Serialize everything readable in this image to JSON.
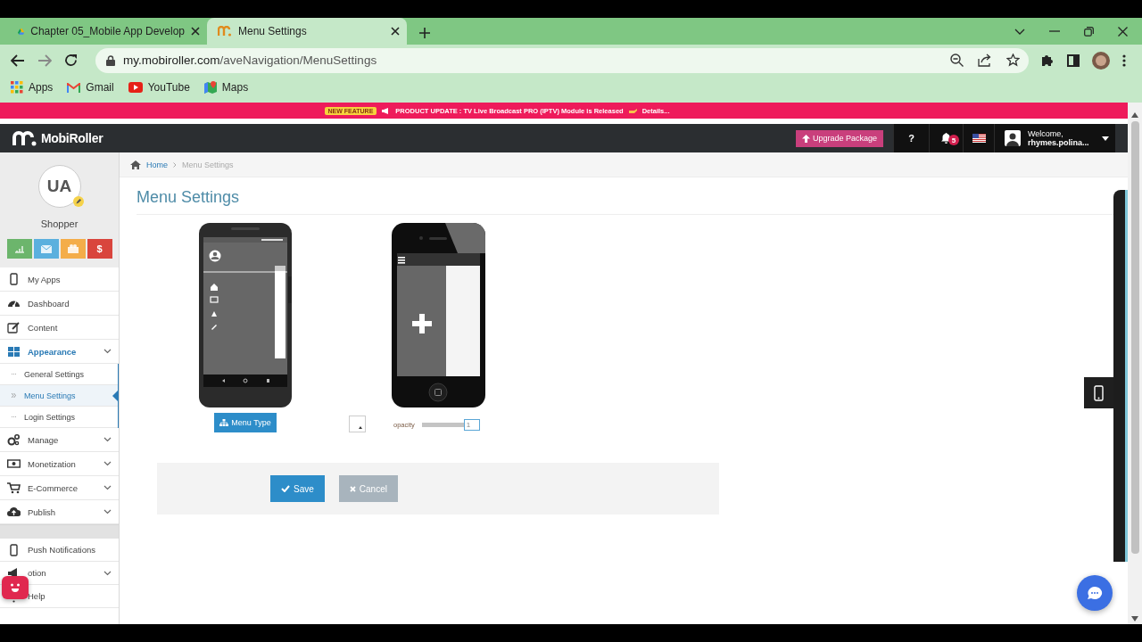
{
  "browser": {
    "tabs": [
      {
        "title": "Chapter 05_Mobile App Develop",
        "selected": false
      },
      {
        "title": "Menu Settings",
        "selected": true
      }
    ],
    "address": {
      "host": "my.mobiroller.com",
      "path": "/aveNavigation/MenuSettings"
    },
    "bookmarks": [
      {
        "label": "Apps"
      },
      {
        "label": "Gmail"
      },
      {
        "label": "YouTube"
      },
      {
        "label": "Maps"
      }
    ]
  },
  "banner": {
    "badge": "NEW FEATURE",
    "text": "PRODUCT UPDATE : TV Live Broadcast PRO (IPTV) Module is Released",
    "link": "Details..."
  },
  "header": {
    "logo": "MobiRoller",
    "upgrade_button": "Upgrade Package",
    "help": "?",
    "notification_count": "5",
    "welcome": "Welcome,",
    "user": "rhymes.polina..."
  },
  "profile": {
    "initials": "UA",
    "name": "Shopper",
    "tiles": [
      {
        "color": "#6cb56c"
      },
      {
        "color": "#5bb0de"
      },
      {
        "color": "#f4ad49"
      },
      {
        "color": "#d9453d",
        "symbol": "$"
      }
    ]
  },
  "sidebar": {
    "items": [
      {
        "label": "My Apps",
        "kind": "link",
        "selected": false
      },
      {
        "label": "Dashboard",
        "kind": "link",
        "selected": false
      },
      {
        "label": "Content",
        "kind": "link",
        "selected": false
      },
      {
        "label": "Appearance",
        "kind": "group",
        "selected": true,
        "children": [
          {
            "label": "General Settings",
            "selected": false
          },
          {
            "label": "Menu Settings",
            "selected": true
          },
          {
            "label": "Login Settings",
            "selected": false
          }
        ]
      },
      {
        "label": "Manage",
        "kind": "group",
        "selected": false
      },
      {
        "label": "Monetization",
        "kind": "group",
        "selected": false
      },
      {
        "label": "E-Commerce",
        "kind": "group",
        "selected": false
      },
      {
        "label": "Publish",
        "kind": "group",
        "selected": false
      }
    ],
    "bottom_items": [
      {
        "label": "Push Notifications",
        "kind": "link",
        "selected": false
      },
      {
        "label": "otion",
        "kind": "group",
        "selected": false
      },
      {
        "label": "Help",
        "kind": "link",
        "selected": false
      }
    ]
  },
  "breadcrumb": [
    "Home",
    "Menu Settings"
  ],
  "page_title": "Menu Settings",
  "menu_type_button": "Menu Type",
  "opacity": {
    "label": "opacity",
    "level": 1,
    "value": "1"
  },
  "buttons": [
    {
      "label": "Save",
      "kind": "primary"
    },
    {
      "label": "Cancel",
      "kind": "secondary"
    }
  ]
}
